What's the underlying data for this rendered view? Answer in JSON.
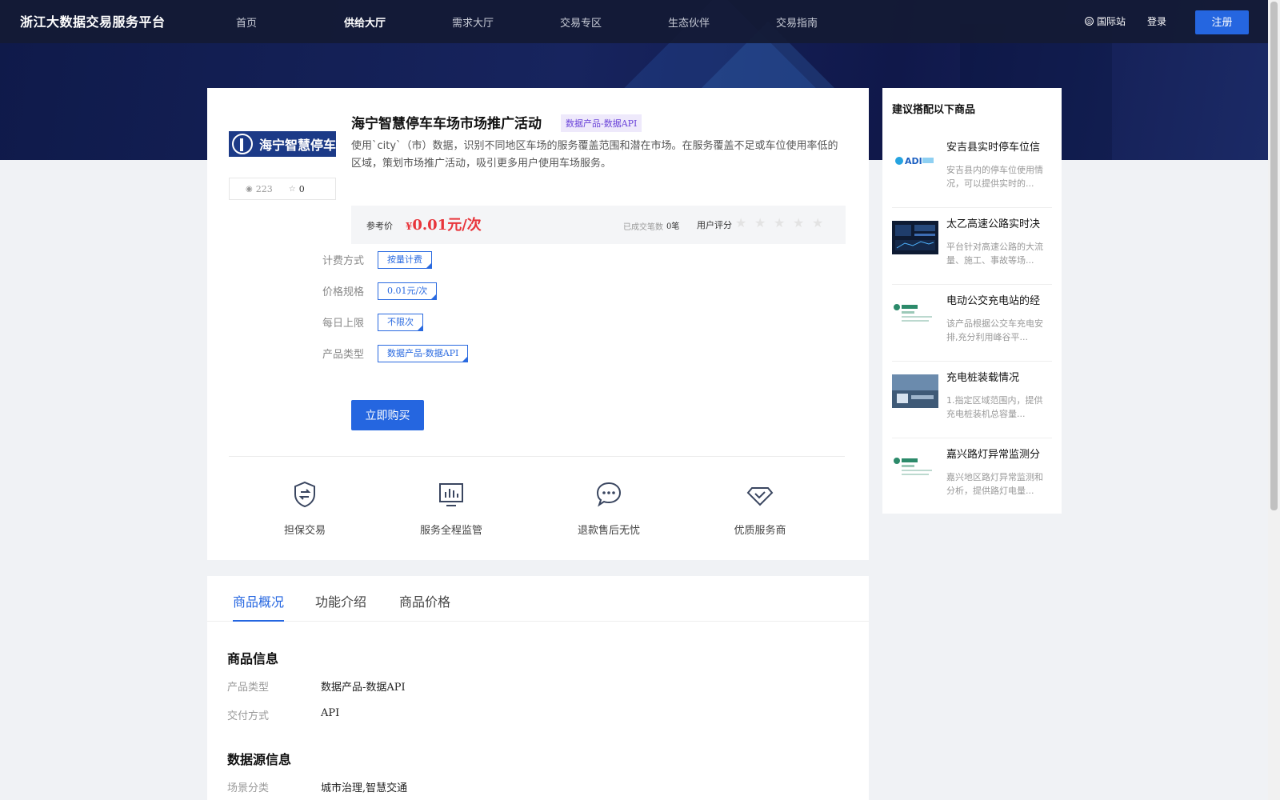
{
  "header": {
    "logo": "浙江大数据交易服务平台",
    "nav": [
      "首页",
      "供给大厅",
      "需求大厅",
      "交易专区",
      "生态伙伴",
      "交易指南"
    ],
    "active_nav": 1,
    "intl": "国际站",
    "login": "登录",
    "register": "注册"
  },
  "product": {
    "logo_text": "海宁智慧停车",
    "views": "223",
    "favorites": "0",
    "title": "海宁智慧停车车场市场推广活动",
    "tag": "数据产品-数据API",
    "description": "使用`city`（市）数据，识别不同地区车场的服务覆盖范围和潜在市场。在服务覆盖不足或车位使用率低的区域，策划市场推广活动，吸引更多用户使用车场服务。",
    "price_label": "参考价",
    "price_symbol": "¥",
    "price": "0.01元/次",
    "deal_label": "已成交笔数",
    "deal_count": "0笔",
    "rating_label": "用户评分",
    "rating_stars": 0,
    "specs": [
      {
        "label": "计费方式",
        "value": "按量计费"
      },
      {
        "label": "价格规格",
        "value": "0.01元/次"
      },
      {
        "label": "每日上限",
        "value": "不限次"
      },
      {
        "label": "产品类型",
        "value": "数据产品-数据API"
      }
    ],
    "buy_label": "立即购买",
    "guarantees": [
      {
        "label": "担保交易",
        "icon": "shield-exchange-icon"
      },
      {
        "label": "服务全程监管",
        "icon": "monitor-chart-icon"
      },
      {
        "label": "退款售后无忧",
        "icon": "chat-bubble-icon"
      },
      {
        "label": "优质服务商",
        "icon": "diamond-check-icon"
      }
    ]
  },
  "sidebar": {
    "title": "建议搭配以下商品",
    "items": [
      {
        "name": "安吉县实时停车位信",
        "desc": "安吉县内的停车位使用情况，可以提供实时的..."
      },
      {
        "name": "太乙高速公路实时决",
        "desc": "平台针对高速公路的大流量、施工、事故等场..."
      },
      {
        "name": "电动公交充电站的经",
        "desc": "该产品根据公交车充电安排,充分利用峰谷平..."
      },
      {
        "name": "充电桩装载情况",
        "desc": "1.指定区域范围内，提供充电桩装机总容量..."
      },
      {
        "name": "嘉兴路灯异常监测分",
        "desc": "嘉兴地区路灯异常监测和分析，提供路灯电量..."
      }
    ]
  },
  "tabs": {
    "items": [
      "商品概况",
      "功能介绍",
      "商品价格"
    ],
    "active": 0
  },
  "detail": {
    "section1_title": "商品信息",
    "type_key": "产品类型",
    "type_val": "数据产品-数据API",
    "delivery_key": "交付方式",
    "delivery_val": "API",
    "section2_title": "数据源信息",
    "scene_key": "场景分类",
    "scene_val": "城市治理,智慧交通"
  },
  "colors": {
    "primary": "#2566e0",
    "price": "#e8353b",
    "tag_bg": "#eee9fb",
    "tag_text": "#6b44d9",
    "header_bg": "#141a34"
  }
}
